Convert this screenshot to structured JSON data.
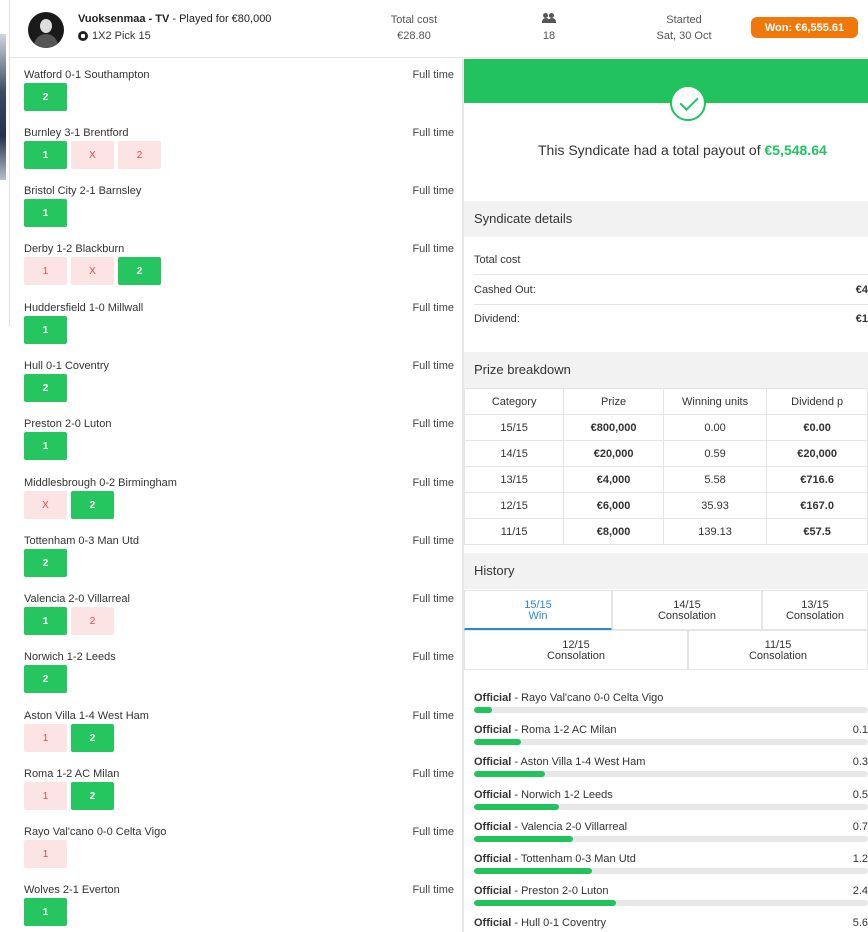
{
  "header": {
    "player_name": "Vuoksenmaa - TV",
    "played_for": "- Played for €80,000",
    "game": "1X2 Pick 15",
    "total_cost_label": "Total cost",
    "total_cost_value": "€28.80",
    "participants": "18",
    "started_label": "Started",
    "started_value": "Sat, 30 Oct",
    "won_badge": "Won: €6,555.61"
  },
  "matches": [
    {
      "teams": "Watford 0-1 Southampton",
      "status": "Full time",
      "picks": [
        {
          "label": "2",
          "result": "win"
        }
      ]
    },
    {
      "teams": "Burnley 3-1 Brentford",
      "status": "Full time",
      "picks": [
        {
          "label": "1",
          "result": "win"
        },
        {
          "label": "X",
          "result": "lose"
        },
        {
          "label": "2",
          "result": "lose"
        }
      ]
    },
    {
      "teams": "Bristol City 2-1 Barnsley",
      "status": "Full time",
      "picks": [
        {
          "label": "1",
          "result": "win"
        }
      ]
    },
    {
      "teams": "Derby 1-2 Blackburn",
      "status": "Full time",
      "picks": [
        {
          "label": "1",
          "result": "lose"
        },
        {
          "label": "X",
          "result": "lose"
        },
        {
          "label": "2",
          "result": "win"
        }
      ]
    },
    {
      "teams": "Huddersfield 1-0 Millwall",
      "status": "Full time",
      "picks": [
        {
          "label": "1",
          "result": "win"
        }
      ]
    },
    {
      "teams": "Hull 0-1 Coventry",
      "status": "Full time",
      "picks": [
        {
          "label": "2",
          "result": "win"
        }
      ]
    },
    {
      "teams": "Preston 2-0 Luton",
      "status": "Full time",
      "picks": [
        {
          "label": "1",
          "result": "win"
        }
      ]
    },
    {
      "teams": "Middlesbrough 0-2 Birmingham",
      "status": "Full time",
      "picks": [
        {
          "label": "X",
          "result": "lose"
        },
        {
          "label": "2",
          "result": "win"
        }
      ]
    },
    {
      "teams": "Tottenham 0-3 Man Utd",
      "status": "Full time",
      "picks": [
        {
          "label": "2",
          "result": "win"
        }
      ]
    },
    {
      "teams": "Valencia 2-0 Villarreal",
      "status": "Full time",
      "picks": [
        {
          "label": "1",
          "result": "win"
        },
        {
          "label": "2",
          "result": "lose"
        }
      ]
    },
    {
      "teams": "Norwich 1-2 Leeds",
      "status": "Full time",
      "picks": [
        {
          "label": "2",
          "result": "win"
        }
      ]
    },
    {
      "teams": "Aston Villa 1-4 West Ham",
      "status": "Full time",
      "picks": [
        {
          "label": "1",
          "result": "lose"
        },
        {
          "label": "2",
          "result": "win"
        }
      ]
    },
    {
      "teams": "Roma 1-2 AC Milan",
      "status": "Full time",
      "picks": [
        {
          "label": "1",
          "result": "lose"
        },
        {
          "label": "2",
          "result": "win"
        }
      ]
    },
    {
      "teams": "Rayo Val'cano 0-0 Celta Vigo",
      "status": "Full time",
      "picks": [
        {
          "label": "1",
          "result": "lose"
        }
      ]
    },
    {
      "teams": "Wolves 2-1 Everton",
      "status": "Full time",
      "picks": [
        {
          "label": "1",
          "result": "win"
        }
      ]
    }
  ],
  "payout": {
    "text": "This Syndicate had a total payout of",
    "amount": "€5,548.64"
  },
  "syndicate": {
    "title": "Syndicate details",
    "rows": [
      {
        "label": "Total cost",
        "value": ""
      },
      {
        "label": "Cashed Out:",
        "value": "€4"
      },
      {
        "label": "Dividend:",
        "value": "€1"
      }
    ]
  },
  "prize": {
    "title": "Prize breakdown",
    "headers": [
      "Category",
      "Prize",
      "Winning units",
      "Dividend p"
    ],
    "rows": [
      [
        "15/15",
        "€800,000",
        "0.00",
        "€0.00"
      ],
      [
        "14/15",
        "€20,000",
        "0.59",
        "€20,000"
      ],
      [
        "13/15",
        "€4,000",
        "5.58",
        "€716.6"
      ],
      [
        "12/15",
        "€6,000",
        "35.93",
        "€167.0"
      ],
      [
        "11/15",
        "€8,000",
        "139.13",
        "€57.5"
      ]
    ]
  },
  "history": {
    "title": "History",
    "tabs": [
      {
        "line1": "15/15",
        "line2": "Win"
      },
      {
        "line1": "14/15",
        "line2": "Consolation"
      },
      {
        "line1": "13/15",
        "line2": "Consolation"
      },
      {
        "line1": "12/15",
        "line2": "Consolation"
      },
      {
        "line1": "11/15",
        "line2": "Consolation"
      }
    ],
    "rows": [
      {
        "prefix": "Official",
        "match": "- Rayo Val'cano 0-0 Celta Vigo",
        "value": "",
        "fill": 0.045
      },
      {
        "prefix": "Official",
        "match": "- Roma 1-2 AC Milan",
        "value": "0.1",
        "fill": 0.12
      },
      {
        "prefix": "Official",
        "match": "- Aston Villa 1-4 West Ham",
        "value": "0.3",
        "fill": 0.18
      },
      {
        "prefix": "Official",
        "match": "- Norwich 1-2 Leeds",
        "value": "0.5",
        "fill": 0.215
      },
      {
        "prefix": "Official",
        "match": "- Valencia 2-0 Villarreal",
        "value": "0.7",
        "fill": 0.25
      },
      {
        "prefix": "Official",
        "match": "- Tottenham 0-3 Man Utd",
        "value": "1.2",
        "fill": 0.3
      },
      {
        "prefix": "Official",
        "match": "- Preston 2-0 Luton",
        "value": "2.4",
        "fill": 0.36
      },
      {
        "prefix": "Official",
        "match": "- Hull 0-1 Coventry",
        "value": "5.6",
        "fill": 0.45
      }
    ]
  },
  "colors": {
    "green": "#22c35e",
    "orange": "#f0780a",
    "lose_bg": "#fde4e4",
    "lose_text": "#e0474c",
    "active_tab": "#2a8ad6"
  }
}
